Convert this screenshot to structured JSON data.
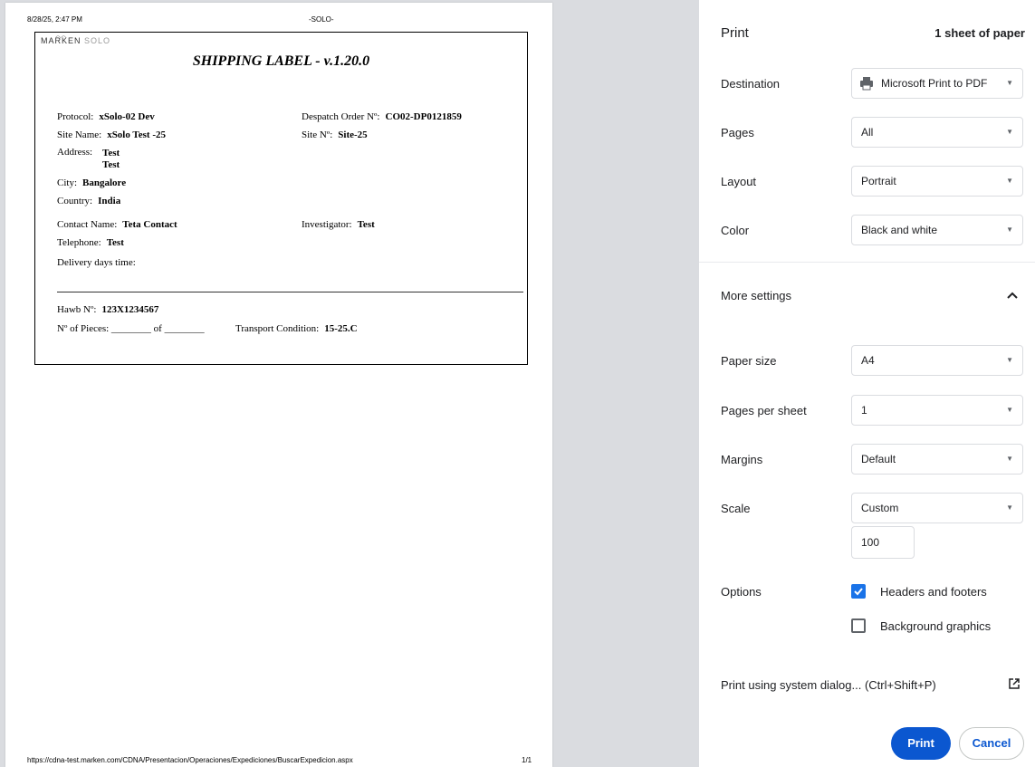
{
  "page_header": {
    "date": "8/28/25, 2:47 PM",
    "title": "-SOLO-"
  },
  "page_footer": {
    "url": "https://cdna-test.marken.com/CDNA/Presentacion/Operaciones/Expediciones/BuscarExpedicion.aspx",
    "page": "1/1"
  },
  "label": {
    "logo_text": "MARKEN",
    "logo_sub": "SOLO",
    "title": "SHIPPING LABEL - v.1.20.0",
    "protocol_label": "Protocol:",
    "protocol": "xSolo-02 Dev",
    "despatch_label": "Despatch Order Nº:",
    "despatch": "CO02-DP0121859",
    "site_name_label": "Site Name:",
    "site_name": "xSolo Test -25",
    "site_no_label": "Site Nº:",
    "site_no": "Site-25",
    "address_label": "Address:",
    "address_line1": "Test",
    "address_line2": "Test",
    "city_label": "City:",
    "city": "Bangalore",
    "country_label": "Country:",
    "country": "India",
    "contact_label": "Contact Name:",
    "contact": "Teta Contact",
    "investigator_label": "Investigator:",
    "investigator": "Test",
    "telephone_label": "Telephone:",
    "telephone": "Test",
    "delivery_label": "Delivery days time:",
    "hawb_label": "Hawb Nº:",
    "hawb": "123X1234567",
    "pieces_text": "Nº of Pieces: ________ of ________",
    "transport_label": "Transport Condition:",
    "transport": "15-25.C"
  },
  "panel": {
    "title": "Print",
    "sheet_count": "1 sheet of paper",
    "destination_label": "Destination",
    "destination_value": "Microsoft Print to PDF",
    "pages_label": "Pages",
    "pages_value": "All",
    "layout_label": "Layout",
    "layout_value": "Portrait",
    "color_label": "Color",
    "color_value": "Black and white",
    "more_settings_label": "More settings",
    "paper_size_label": "Paper size",
    "paper_size_value": "A4",
    "pages_per_sheet_label": "Pages per sheet",
    "pages_per_sheet_value": "1",
    "margins_label": "Margins",
    "margins_value": "Default",
    "scale_label": "Scale",
    "scale_value": "Custom",
    "scale_input": "100",
    "options_label": "Options",
    "headers_footers_label": "Headers and footers",
    "headers_footers_checked": true,
    "background_graphics_label": "Background graphics",
    "background_graphics_checked": false,
    "system_dialog_label": "Print using system dialog... (Ctrl+Shift+P)",
    "print_button": "Print",
    "cancel_button": "Cancel",
    "accent_color": "#0b57d0"
  }
}
